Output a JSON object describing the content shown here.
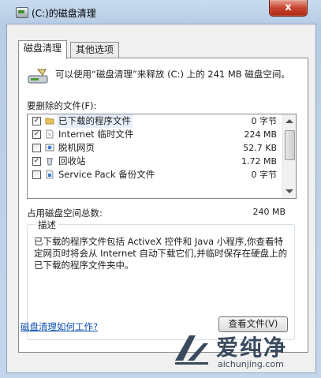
{
  "window": {
    "title": "(C:)的磁盘清理",
    "close_glyph": "x"
  },
  "tabs": [
    {
      "label": "磁盘清理"
    },
    {
      "label": "其他选项"
    }
  ],
  "intro_text": "可以使用“磁盘清理”来释放 (C:) 上的 241 MB 磁盘空间。",
  "files_label": "要删除的文件(F):",
  "files": [
    {
      "checked": true,
      "check_glyph": "✓",
      "icon": "folder-icon",
      "name": "已下载的程序文件",
      "size": "0 字节"
    },
    {
      "checked": true,
      "check_glyph": "✓",
      "icon": "document-icon",
      "name": "Internet 临时文件",
      "size": "224 MB"
    },
    {
      "checked": false,
      "check_glyph": "",
      "icon": "web-page-icon",
      "name": "脱机网页",
      "size": "52.7 KB"
    },
    {
      "checked": true,
      "check_glyph": "✓",
      "icon": "recycle-bin-icon",
      "name": "回收站",
      "size": "1.72 MB"
    },
    {
      "checked": false,
      "check_glyph": "",
      "icon": "service-pack-icon",
      "name": "Service Pack 备份文件",
      "size": "0 字节"
    }
  ],
  "total_label": "占用磁盘空间总数:",
  "total_value": "240 MB",
  "description": {
    "title": "描述",
    "text": "已下载的程序文件包括 ActiveX 控件和 Java 小程序,你查看特定网页时将会从 Internet 自动下载它们,并临时保存在硬盘上的已下载的程序文件夹中。",
    "view_button": "查看文件(V)"
  },
  "help_link": "磁盘清理如何工作?",
  "watermark": {
    "title": "爱纯净",
    "url": "aichunjing.com"
  },
  "colors": {
    "link": "#0b4fb0",
    "close": "#c7452f",
    "watermark": "#3a4a5e"
  }
}
